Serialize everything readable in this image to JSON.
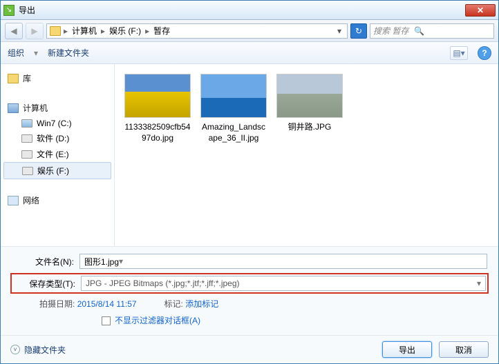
{
  "window": {
    "title": "导出"
  },
  "breadcrumb": {
    "items": [
      "计算机",
      "娱乐 (F:)",
      "暂存"
    ]
  },
  "search": {
    "placeholder": "搜索 暂存"
  },
  "toolbar": {
    "organize": "组织",
    "newfolder": "新建文件夹"
  },
  "sidebar": {
    "library": "库",
    "computer": "计算机",
    "drives": [
      {
        "label": "Win7 (C:)"
      },
      {
        "label": "软件 (D:)"
      },
      {
        "label": "文件 (E:)"
      },
      {
        "label": "娱乐 (F:)"
      }
    ],
    "network": "网络"
  },
  "files": [
    {
      "name": "1133382509cfb5497do.jpg"
    },
    {
      "name": "Amazing_Landscape_36_II.jpg"
    },
    {
      "name": "铜井路.JPG"
    }
  ],
  "form": {
    "filename_label": "文件名(N):",
    "filename_value": "图形1.jpg",
    "filetype_label": "保存类型(T):",
    "filetype_value": "JPG - JPEG Bitmaps (*.jpg;*.jtf;*.jff;*.jpeg)",
    "date_label": "拍摄日期:",
    "date_value": "2015/8/14 11:57",
    "tag_label": "标记:",
    "tag_value": "添加标记",
    "filter_checkbox": "不显示过滤器对话框(A)"
  },
  "actions": {
    "hide_folders": "隐藏文件夹",
    "export": "导出",
    "cancel": "取消"
  }
}
